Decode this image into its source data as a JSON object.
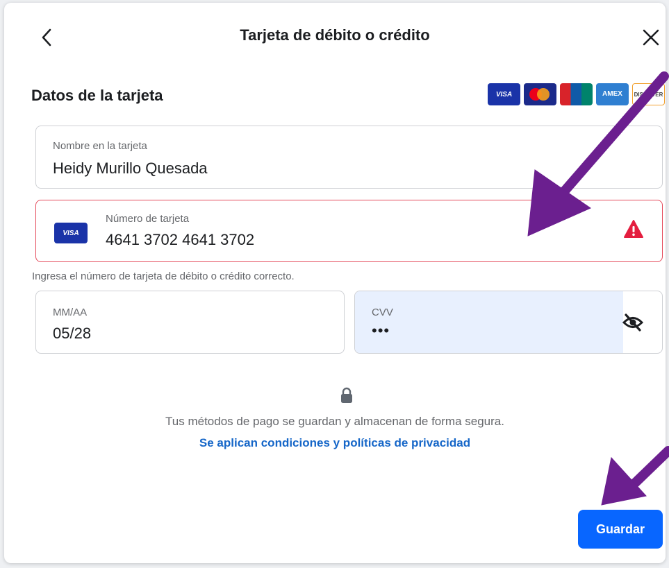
{
  "header": {
    "title": "Tarjeta de débito o crédito",
    "back_icon": "chevron-left-icon",
    "close_icon": "close-icon"
  },
  "section": {
    "title": "Datos de la tarjeta",
    "accepted_cards": [
      "VISA",
      "Mastercard",
      "UnionPay",
      "AMEX",
      "DISCOVER"
    ]
  },
  "form": {
    "name": {
      "label": "Nombre en la tarjeta",
      "value": "Heidy Murillo Quesada"
    },
    "number": {
      "label": "Número de tarjeta",
      "value": "4641 3702 4641 3702",
      "brand": "VISA",
      "error": "Ingresa el número de tarjeta de débito o crédito correcto.",
      "error_icon": "warning-icon",
      "error_color": "#e41e3f"
    },
    "expiry": {
      "label": "MM/AA",
      "value": "05/28"
    },
    "cvv": {
      "label": "CVV",
      "value": "•••",
      "toggle_icon": "eye-slash-icon"
    }
  },
  "security": {
    "icon": "lock-icon",
    "text": "Tus métodos de pago se guardan y almacenan de forma segura.",
    "link": "Se aplican condiciones y políticas de privacidad"
  },
  "actions": {
    "save_label": "Guardar",
    "accent": "#0866ff"
  },
  "annotations": {
    "arrow_color": "#6a1b8a"
  }
}
